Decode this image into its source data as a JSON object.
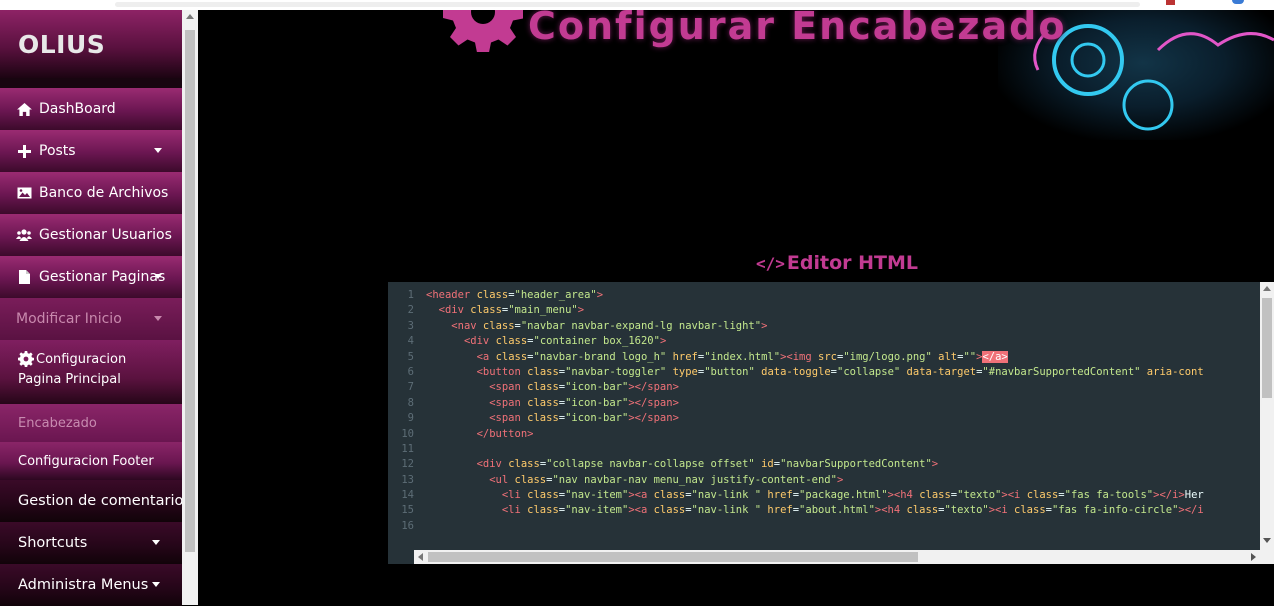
{
  "brand": "OLIUS",
  "sidebar": {
    "items": [
      {
        "label": "DashBoard",
        "icon": "home-icon"
      },
      {
        "label": "Posts",
        "icon": "plus-icon"
      },
      {
        "label": "Banco de Archivos",
        "icon": "image-icon"
      },
      {
        "label": "Gestionar Usuarios",
        "icon": "users-icon"
      },
      {
        "label": "Gestionar Paginas",
        "icon": "file-icon"
      },
      {
        "label": "Modificar Inicio"
      }
    ],
    "sub": {
      "config_line1": "Configuracion",
      "config_line2": "Pagina Principal",
      "encabezado": "Encabezado",
      "footer": "Configuracion Footer"
    },
    "bottom": [
      {
        "label": "Gestion de comentarios"
      },
      {
        "label": "Shortcuts"
      },
      {
        "label": "Administra Menus"
      }
    ]
  },
  "banner": {
    "title": "Configurar Encabezado"
  },
  "editor": {
    "heading_tag": "</>",
    "heading": "Editor HTML",
    "lines": [
      {
        "n": "1",
        "html": "<span class=\"t\">&lt;header</span> <span class=\"a\">class</span>=<span class=\"s\">\"header_area\"</span><span class=\"t\">&gt;</span>"
      },
      {
        "n": "2",
        "html": "  <span class=\"t\">&lt;div</span> <span class=\"a\">class</span>=<span class=\"s\">\"main_menu\"</span><span class=\"t\">&gt;</span>"
      },
      {
        "n": "3",
        "html": "    <span class=\"t\">&lt;nav</span> <span class=\"a\">class</span>=<span class=\"s\">\"navbar navbar-expand-lg navbar-light\"</span><span class=\"t\">&gt;</span>"
      },
      {
        "n": "4",
        "html": "      <span class=\"t\">&lt;div</span> <span class=\"a\">class</span>=<span class=\"s\">\"container box_1620\"</span><span class=\"t\">&gt;</span>"
      },
      {
        "n": "5",
        "html": "        <span class=\"t\">&lt;a</span> <span class=\"a\">class</span>=<span class=\"s\">\"navbar-brand logo_h\"</span> <span class=\"a\">href</span>=<span class=\"s\">\"index.html\"</span><span class=\"t\">&gt;&lt;img</span> <span class=\"a\">src</span>=<span class=\"s\">\"img/logo.png\"</span> <span class=\"a\">alt</span>=<span class=\"s\">\"\"</span><span class=\"t\">&gt;</span><span class=\"hl\">&lt;/a&gt;</span>"
      },
      {
        "n": "6",
        "html": "        <span class=\"t\">&lt;button</span> <span class=\"a\">class</span>=<span class=\"s\">\"navbar-toggler\"</span> <span class=\"a\">type</span>=<span class=\"s\">\"button\"</span> <span class=\"a\">data-toggle</span>=<span class=\"s\">\"collapse\"</span> <span class=\"a\">data-target</span>=<span class=\"s\">\"#navbarSupportedContent\"</span> <span class=\"a\">aria-cont</span>"
      },
      {
        "n": "7",
        "html": "          <span class=\"t\">&lt;span</span> <span class=\"a\">class</span>=<span class=\"s\">\"icon-bar\"</span><span class=\"t\">&gt;&lt;/span&gt;</span>"
      },
      {
        "n": "8",
        "html": "          <span class=\"t\">&lt;span</span> <span class=\"a\">class</span>=<span class=\"s\">\"icon-bar\"</span><span class=\"t\">&gt;&lt;/span&gt;</span>"
      },
      {
        "n": "9",
        "html": "          <span class=\"t\">&lt;span</span> <span class=\"a\">class</span>=<span class=\"s\">\"icon-bar\"</span><span class=\"t\">&gt;&lt;/span&gt;</span>"
      },
      {
        "n": "10",
        "html": "        <span class=\"t\">&lt;/button&gt;</span>"
      },
      {
        "n": "11",
        "html": ""
      },
      {
        "n": "12",
        "html": "        <span class=\"t\">&lt;div</span> <span class=\"a\">class</span>=<span class=\"s\">\"collapse navbar-collapse offset\"</span> <span class=\"a\">id</span>=<span class=\"s\">\"navbarSupportedContent\"</span><span class=\"t\">&gt;</span>"
      },
      {
        "n": "13",
        "html": "          <span class=\"t\">&lt;ul</span> <span class=\"a\">class</span>=<span class=\"s\">\"nav navbar-nav menu_nav justify-content-end\"</span><span class=\"t\">&gt;</span>"
      },
      {
        "n": "14",
        "html": "            <span class=\"t\">&lt;li</span> <span class=\"a\">class</span>=<span class=\"s\">\"nav-item\"</span><span class=\"t\">&gt;&lt;a</span> <span class=\"a\">class</span>=<span class=\"s\">\"nav-link \"</span> <span class=\"a\">href</span>=<span class=\"s\">\"package.html\"</span><span class=\"t\">&gt;&lt;h4</span> <span class=\"a\">class</span>=<span class=\"s\">\"texto\"</span><span class=\"t\">&gt;&lt;i</span> <span class=\"a\">class</span>=<span class=\"s\">\"fas fa-tools\"</span><span class=\"t\">&gt;&lt;/i&gt;</span>Her"
      },
      {
        "n": "15",
        "html": "            <span class=\"t\">&lt;li</span> <span class=\"a\">class</span>=<span class=\"s\">\"nav-item\"</span><span class=\"t\">&gt;&lt;a</span> <span class=\"a\">class</span>=<span class=\"s\">\"nav-link \"</span> <span class=\"a\">href</span>=<span class=\"s\">\"about.html\"</span><span class=\"t\">&gt;&lt;h4</span> <span class=\"a\">class</span>=<span class=\"s\">\"texto\"</span><span class=\"t\">&gt;&lt;i</span> <span class=\"a\">class</span>=<span class=\"s\">\"fas fa-info-circle\"</span><span class=\"t\">&gt;&lt;/i</span>"
      },
      {
        "n": "16",
        "html": ""
      }
    ]
  },
  "colors": {
    "accent": "#c23b92",
    "sidebar": "#8e2366",
    "editor_bg": "#263238"
  }
}
